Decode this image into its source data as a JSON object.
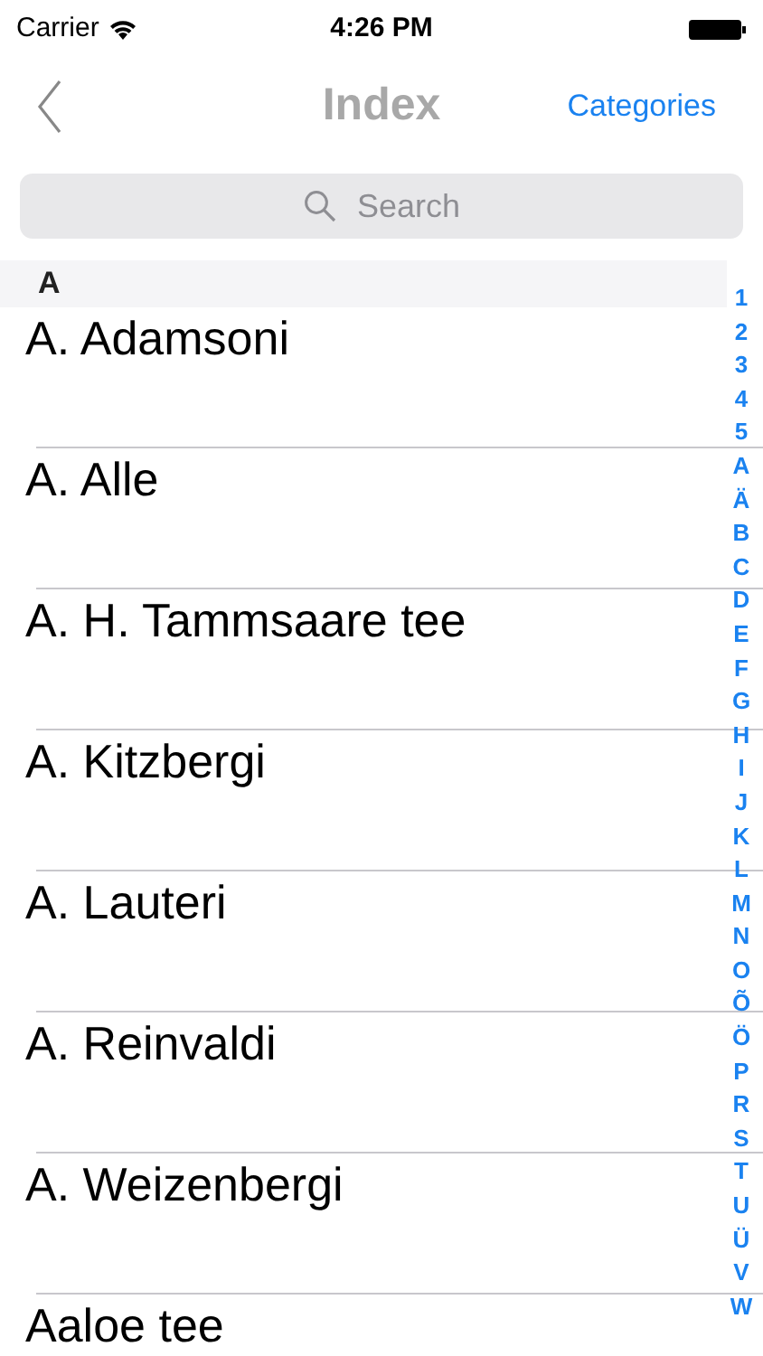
{
  "status_bar": {
    "carrier": "Carrier",
    "time": "4:26 PM"
  },
  "nav_bar": {
    "title": "Index",
    "right_button": "Categories"
  },
  "search": {
    "placeholder": "Search"
  },
  "sections": [
    {
      "header": "A",
      "rows": [
        "A. Adamsoni",
        "A. Alle",
        "A. H. Tammsaare tee",
        "A. Kitzbergi",
        "A. Lauteri",
        "A. Reinvaldi",
        "A. Weizenbergi",
        "Aaloe tee"
      ]
    }
  ],
  "section_index": [
    "1",
    "2",
    "3",
    "4",
    "5",
    "A",
    "Ä",
    "B",
    "C",
    "D",
    "E",
    "F",
    "G",
    "H",
    "I",
    "J",
    "K",
    "L",
    "M",
    "N",
    "O",
    "Õ",
    "Ö",
    "P",
    "R",
    "S",
    "T",
    "U",
    "Ü",
    "V",
    "W"
  ]
}
